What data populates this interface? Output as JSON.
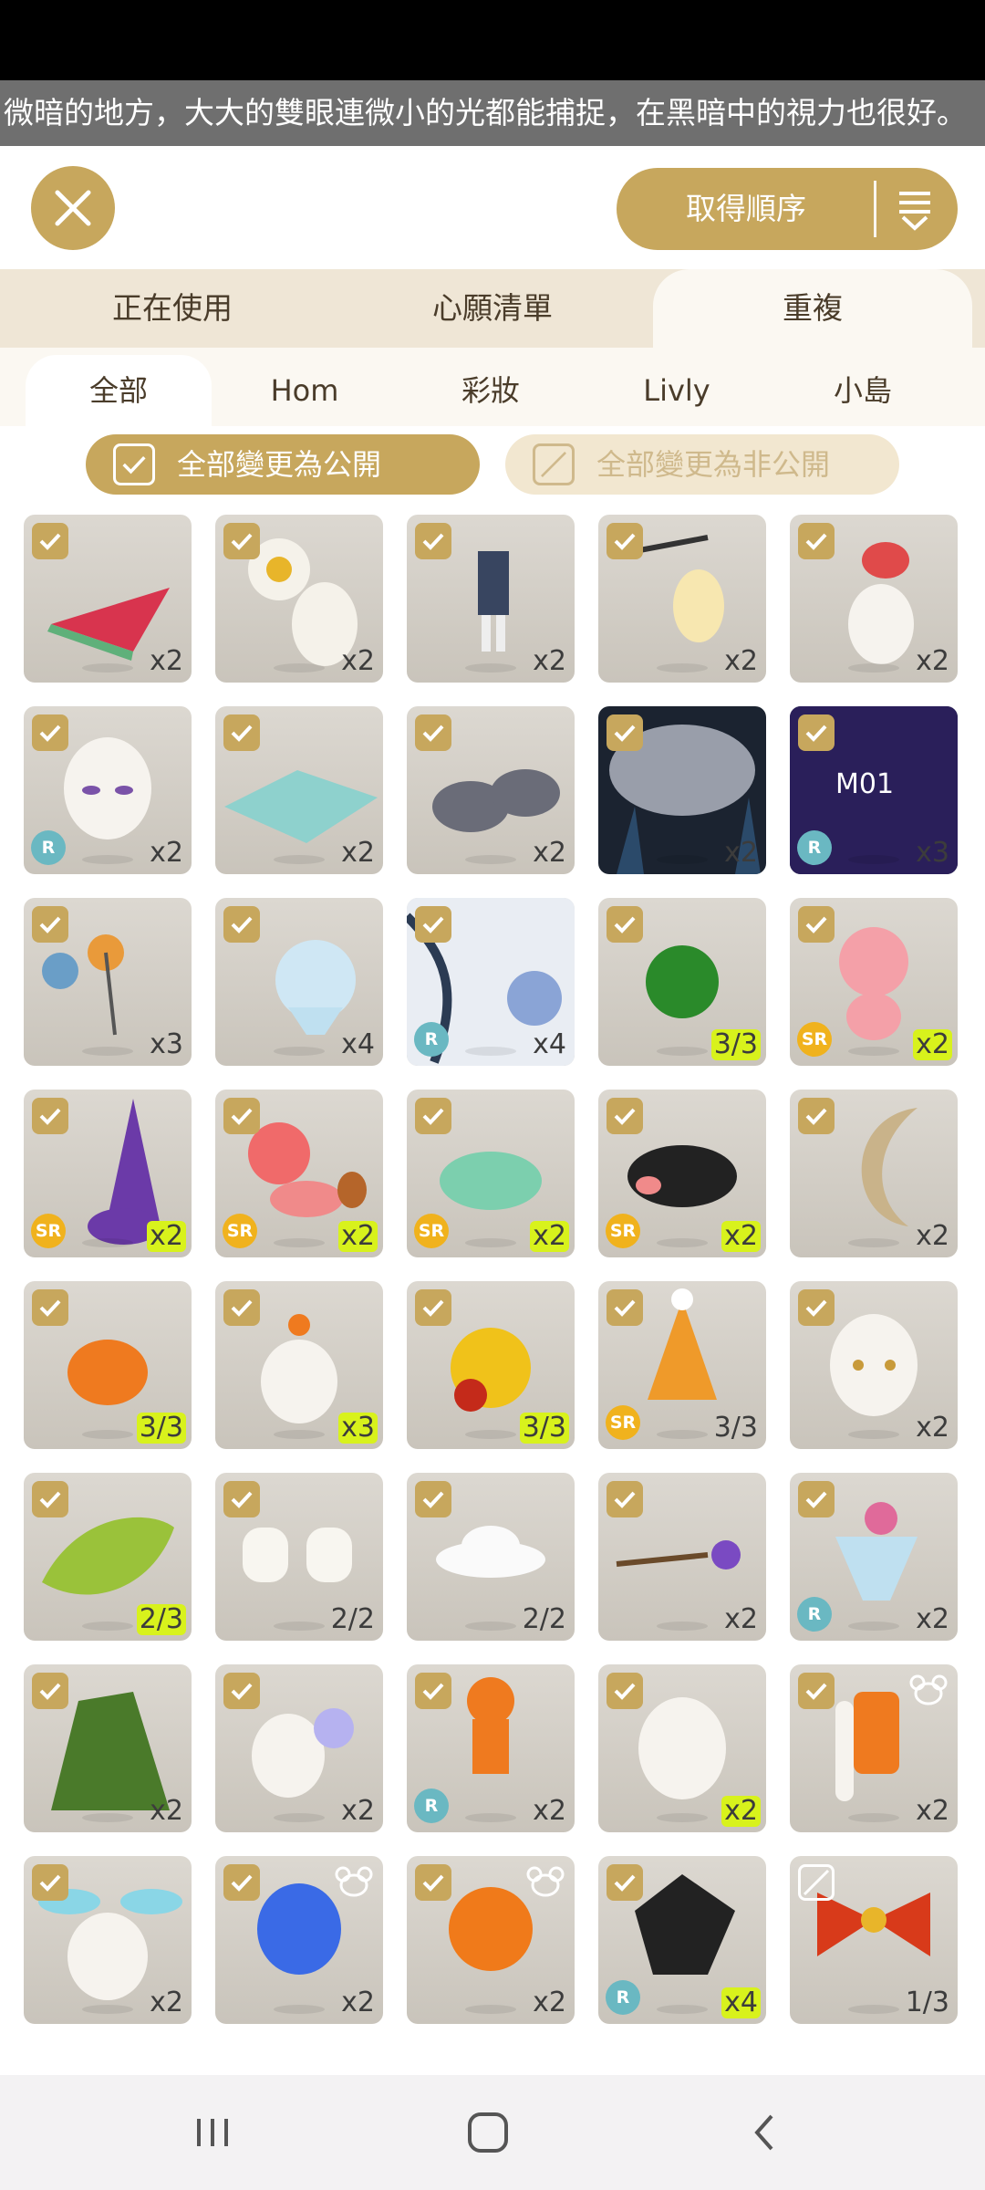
{
  "ticker": {
    "text": "微暗的地方，大大的雙眼連微小的光都能捕捉，在黑暗中的視力也很好。"
  },
  "header": {
    "sort_label": "取得順序"
  },
  "tabs": [
    {
      "label": "正在使用",
      "active": false
    },
    {
      "label": "心願清單",
      "active": false
    },
    {
      "label": "重複",
      "active": true
    }
  ],
  "subtabs": [
    {
      "label": "全部",
      "active": true
    },
    {
      "label": "Hom",
      "active": false
    },
    {
      "label": "彩妝",
      "active": false
    },
    {
      "label": "Livly",
      "active": false
    },
    {
      "label": "小島",
      "active": false
    }
  ],
  "actions": {
    "make_public": "全部變更為公開",
    "make_private": "全部變更為非公開"
  },
  "colors": {
    "accent": "#c7a75d",
    "tab_bg": "#efe6d6",
    "highlight": "#d8f21c",
    "rarity_r": "#6ab8c2",
    "rarity_sr": "#f0b21d"
  },
  "items": [
    {
      "name": "watermelon",
      "count": "x2",
      "hl": false,
      "rarity": "",
      "checked": true,
      "bear": false
    },
    {
      "name": "sunflower-head",
      "count": "x2",
      "hl": false,
      "rarity": "",
      "checked": true,
      "bear": false
    },
    {
      "name": "outfit",
      "count": "x2",
      "hl": false,
      "rarity": "",
      "checked": true,
      "bear": false
    },
    {
      "name": "lantern",
      "count": "x2",
      "hl": false,
      "rarity": "",
      "checked": true,
      "bear": false
    },
    {
      "name": "mushroom-hat",
      "count": "x2",
      "hl": false,
      "rarity": "",
      "checked": true,
      "bear": false
    },
    {
      "name": "face",
      "count": "x2",
      "hl": false,
      "rarity": "R",
      "checked": true,
      "bear": false
    },
    {
      "name": "mat",
      "count": "x2",
      "hl": false,
      "rarity": "",
      "checked": true,
      "bear": false
    },
    {
      "name": "stones",
      "count": "x2",
      "hl": false,
      "rarity": "",
      "checked": true,
      "bear": false
    },
    {
      "name": "dark-bg",
      "count": "x2",
      "hl": false,
      "rarity": "",
      "checked": true,
      "bear": false
    },
    {
      "name": "music-bg",
      "count": "x3",
      "hl": false,
      "rarity": "R",
      "checked": true,
      "bear": false
    },
    {
      "name": "pinwheels",
      "count": "x3",
      "hl": false,
      "rarity": "",
      "checked": true,
      "bear": false
    },
    {
      "name": "shaved-ice",
      "count": "x4",
      "hl": false,
      "rarity": "",
      "checked": true,
      "bear": false
    },
    {
      "name": "morning-glory",
      "count": "x4",
      "hl": false,
      "rarity": "R",
      "checked": true,
      "bear": false
    },
    {
      "name": "green-ball",
      "count": "3/3",
      "hl": true,
      "rarity": "",
      "checked": true,
      "bear": false
    },
    {
      "name": "pink-doll",
      "count": "x2",
      "hl": true,
      "rarity": "SR",
      "checked": true,
      "bear": false
    },
    {
      "name": "purple-creature",
      "count": "x2",
      "hl": true,
      "rarity": "SR",
      "checked": true,
      "bear": false
    },
    {
      "name": "doll-girl",
      "count": "x2",
      "hl": true,
      "rarity": "SR",
      "checked": true,
      "bear": false
    },
    {
      "name": "teal-creature",
      "count": "x2",
      "hl": true,
      "rarity": "SR",
      "checked": true,
      "bear": false
    },
    {
      "name": "black-creature",
      "count": "x2",
      "hl": true,
      "rarity": "SR",
      "checked": true,
      "bear": false
    },
    {
      "name": "moon",
      "count": "x2",
      "hl": false,
      "rarity": "",
      "checked": true,
      "bear": false
    },
    {
      "name": "orange-mushroom",
      "count": "3/3",
      "hl": true,
      "rarity": "",
      "checked": true,
      "bear": false
    },
    {
      "name": "orange-dot-head",
      "count": "x3",
      "hl": true,
      "rarity": "",
      "checked": true,
      "bear": false
    },
    {
      "name": "yellow-drop",
      "count": "3/3",
      "hl": true,
      "rarity": "",
      "checked": true,
      "bear": false
    },
    {
      "name": "party-hat",
      "count": "3/3",
      "hl": false,
      "rarity": "SR",
      "checked": true,
      "bear": false
    },
    {
      "name": "eyes-head",
      "count": "x2",
      "hl": false,
      "rarity": "",
      "checked": true,
      "bear": false
    },
    {
      "name": "leaf",
      "count": "2/3",
      "hl": true,
      "rarity": "",
      "checked": true,
      "bear": false
    },
    {
      "name": "marshmallows",
      "count": "2/2",
      "hl": false,
      "rarity": "",
      "checked": true,
      "bear": false
    },
    {
      "name": "white-hat",
      "count": "2/2",
      "hl": false,
      "rarity": "",
      "checked": true,
      "bear": false
    },
    {
      "name": "grape-spoon",
      "count": "x2",
      "hl": false,
      "rarity": "",
      "checked": true,
      "bear": false
    },
    {
      "name": "parfait",
      "count": "x2",
      "hl": false,
      "rarity": "R",
      "checked": true,
      "bear": false
    },
    {
      "name": "moss-rock",
      "count": "x2",
      "hl": false,
      "rarity": "",
      "checked": true,
      "bear": false
    },
    {
      "name": "flower-head",
      "count": "x2",
      "hl": false,
      "rarity": "",
      "checked": true,
      "bear": false
    },
    {
      "name": "orange-outfit",
      "count": "x2",
      "hl": false,
      "rarity": "R",
      "checked": true,
      "bear": false
    },
    {
      "name": "sleepy-head",
      "count": "x2",
      "hl": true,
      "rarity": "",
      "checked": true,
      "bear": false
    },
    {
      "name": "orange-vest",
      "count": "x2",
      "hl": false,
      "rarity": "",
      "checked": true,
      "bear": true
    },
    {
      "name": "bunny-ears",
      "count": "x2",
      "hl": false,
      "rarity": "",
      "checked": true,
      "bear": false
    },
    {
      "name": "blue-hair",
      "count": "x2",
      "hl": false,
      "rarity": "",
      "checked": true,
      "bear": true
    },
    {
      "name": "orange-hair",
      "count": "x2",
      "hl": false,
      "rarity": "",
      "checked": true,
      "bear": true
    },
    {
      "name": "dark-mask",
      "count": "x4",
      "hl": true,
      "rarity": "R",
      "checked": true,
      "bear": false
    },
    {
      "name": "red-bow",
      "count": "1/3",
      "hl": false,
      "rarity": "",
      "checked": false,
      "bear": false
    }
  ]
}
